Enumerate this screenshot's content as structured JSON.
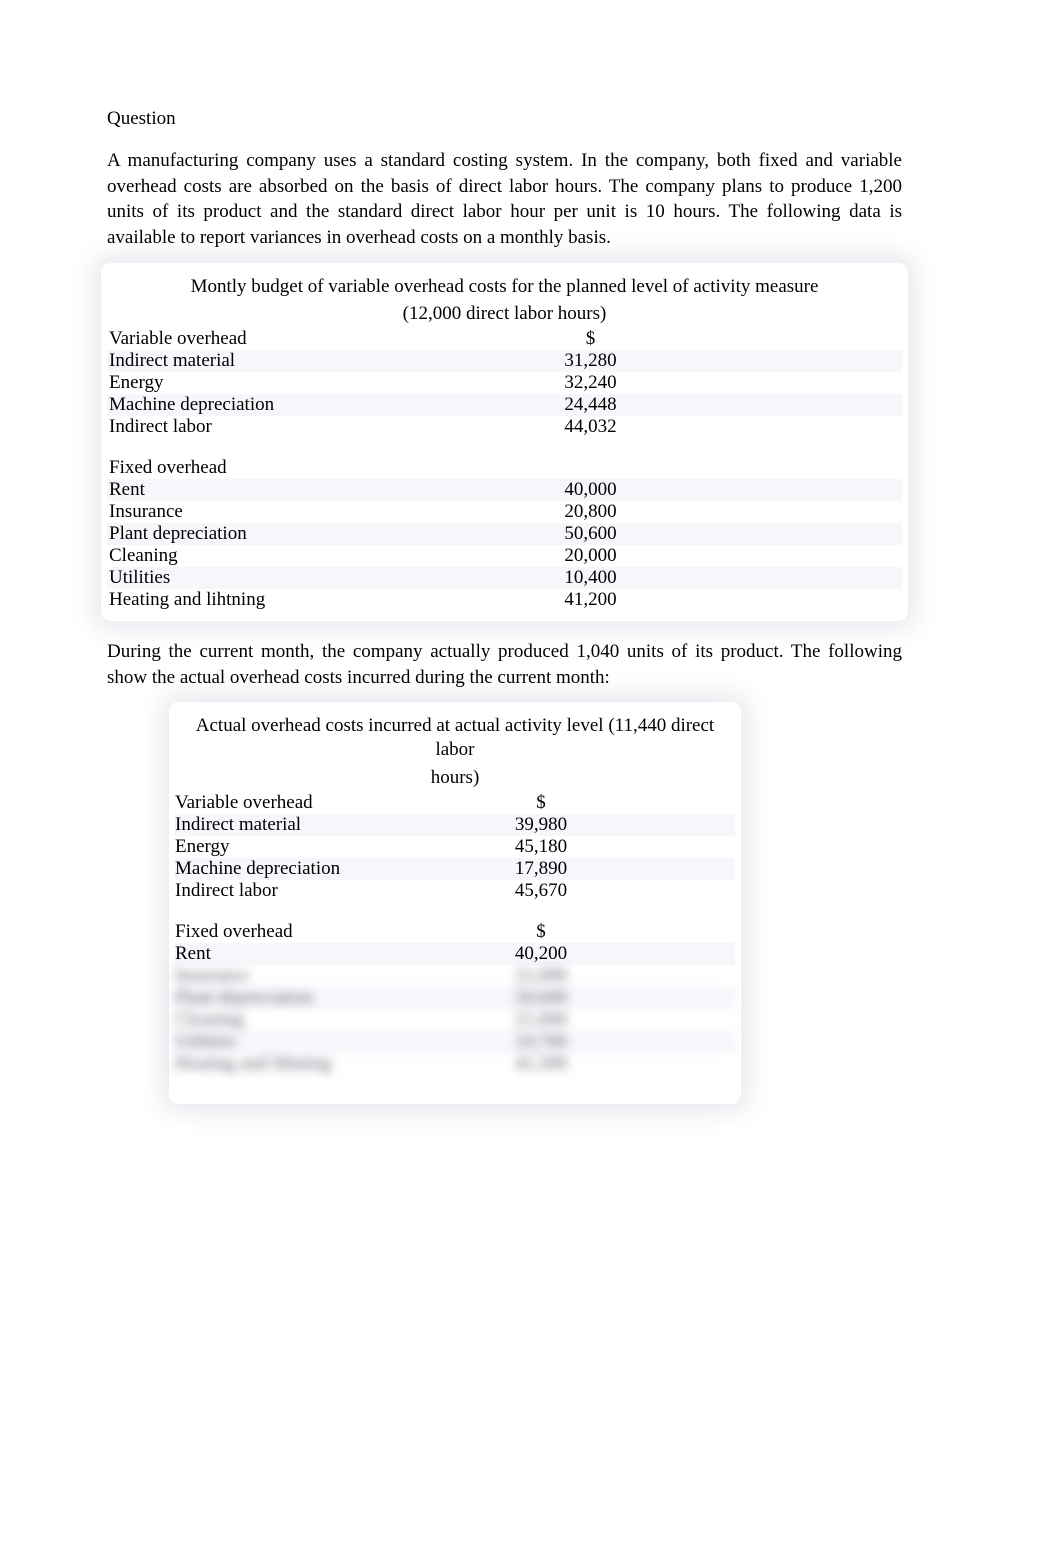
{
  "heading": "Question",
  "paragraph1": "A manufacturing company uses a standard costing system. In the company, both fixed and variable overhead costs are absorbed on the basis of direct labor hours. The company plans to produce 1,200 units of its product and the standard direct labor hour per unit is 10 hours. The following data is available to report variances in overhead costs on a monthly basis.",
  "table1": {
    "caption_line1": "Montly budget of variable overhead costs for the planned level of activity measure",
    "caption_line2": "(12,000 direct labor hours)",
    "var_header": "Variable overhead",
    "currency": "$",
    "var_rows": [
      {
        "label": "Indirect material",
        "value": "31,280"
      },
      {
        "label": "Energy",
        "value": "32,240"
      },
      {
        "label": "Machine depreciation",
        "value": "24,448"
      },
      {
        "label": "Indirect labor",
        "value": "44,032"
      }
    ],
    "fix_header": "Fixed overhead",
    "fix_rows": [
      {
        "label": "Rent",
        "value": "40,000"
      },
      {
        "label": "Insurance",
        "value": "20,800"
      },
      {
        "label": "Plant depreciation",
        "value": "50,600"
      },
      {
        "label": "Cleaning",
        "value": "20,000"
      },
      {
        "label": "Utilities",
        "value": "10,400"
      },
      {
        "label": "Heating and lihtning",
        "value": "41,200"
      }
    ]
  },
  "paragraph2": "During the current month, the company actually produced 1,040 units of its product. The following show the actual overhead costs incurred during the current month:",
  "table2": {
    "caption_line1": "Actual overhead costs incurred at actual activity level (11,440 direct labor",
    "caption_line2": "hours)",
    "var_header": "Variable overhead",
    "currency": "$",
    "var_rows": [
      {
        "label": "Indirect material",
        "value": "39,980"
      },
      {
        "label": "Energy",
        "value": "45,180"
      },
      {
        "label": "Machine depreciation",
        "value": "17,890"
      },
      {
        "label": "Indirect labor",
        "value": "45,670"
      }
    ],
    "fix_header": "Fixed overhead",
    "fix_currency": "$",
    "fix_rows_visible": [
      {
        "label": "Rent",
        "value": "40,200"
      }
    ],
    "fix_rows_blurred": [
      {
        "label": "Insurance",
        "value": "21,000"
      },
      {
        "label": "Plant depreciation",
        "value": "50,600"
      },
      {
        "label": "Cleaning",
        "value": "21,000"
      },
      {
        "label": "Utilities",
        "value": "10,700"
      },
      {
        "label": "Heating and lihtning",
        "value": "41,500"
      }
    ]
  }
}
